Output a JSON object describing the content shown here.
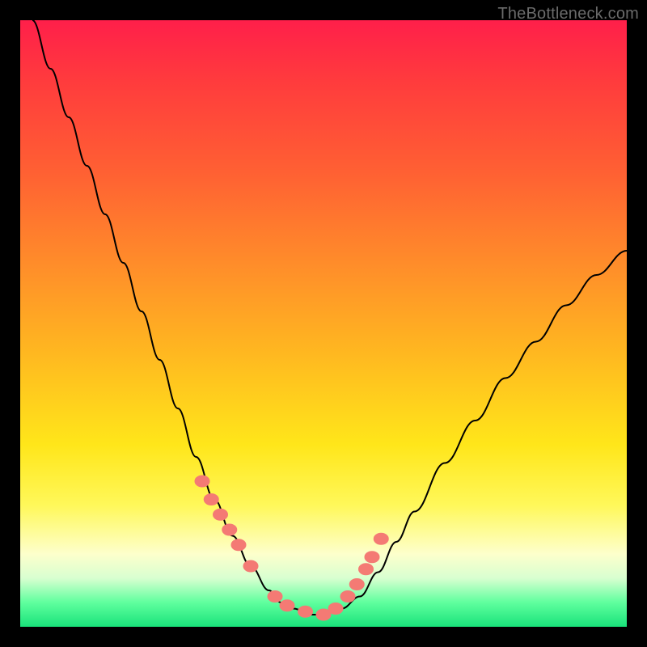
{
  "watermark": "TheBottleneck.com",
  "colors": {
    "dot": "#f47a74",
    "curve": "#000000",
    "frame_bg_top": "#ff1f4a",
    "frame_bg_bottom": "#19e27a",
    "page_bg": "#000000"
  },
  "chart_data": {
    "type": "line",
    "title": "",
    "xlabel": "",
    "ylabel": "",
    "xlim": [
      0,
      100
    ],
    "ylim": [
      0,
      100
    ],
    "grid": false,
    "series": [
      {
        "name": "bottleneck-curve",
        "x": [
          2,
          5,
          8,
          11,
          14,
          17,
          20,
          23,
          26,
          29,
          32,
          35,
          38,
          41,
          43,
          45,
          48,
          50,
          53,
          56,
          59,
          62,
          65,
          70,
          75,
          80,
          85,
          90,
          95,
          100
        ],
        "y": [
          100,
          92,
          84,
          76,
          68,
          60,
          52,
          44,
          36,
          28,
          21,
          15,
          10,
          6,
          4,
          3,
          2,
          2,
          3,
          5,
          9,
          14,
          19,
          27,
          34,
          41,
          47,
          53,
          58,
          62
        ]
      }
    ],
    "markers": {
      "name": "highlighted-points",
      "x": [
        30,
        31.5,
        33,
        34.5,
        36,
        38,
        42,
        44,
        47,
        50,
        52,
        54,
        55.5,
        57,
        58,
        59.5
      ],
      "y": [
        24,
        21,
        18.5,
        16,
        13.5,
        10,
        5,
        3.5,
        2.5,
        2,
        3,
        5,
        7,
        9.5,
        11.5,
        14.5
      ]
    }
  }
}
